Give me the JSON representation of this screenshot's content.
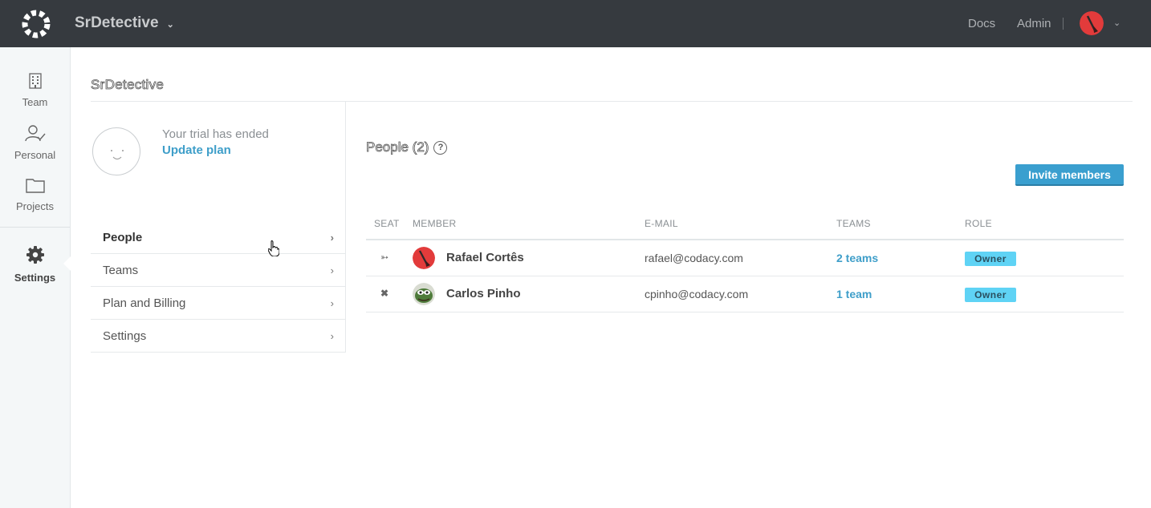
{
  "header": {
    "org_name": "SrDetective",
    "docs_label": "Docs",
    "admin_label": "Admin"
  },
  "nav": {
    "items": [
      {
        "label": "Team",
        "icon": "building-icon"
      },
      {
        "label": "Personal",
        "icon": "user-check-icon"
      },
      {
        "label": "Projects",
        "icon": "folder-icon"
      },
      {
        "label": "Settings",
        "icon": "gear-icon",
        "active": true
      }
    ]
  },
  "page": {
    "title": "SrDetective",
    "trial_text": "Your trial has ended",
    "update_plan_label": "Update plan"
  },
  "side_menu": {
    "items": [
      {
        "label": "People",
        "active": true
      },
      {
        "label": "Teams"
      },
      {
        "label": "Plan and Billing"
      },
      {
        "label": "Settings"
      }
    ]
  },
  "people": {
    "title": "People (2)",
    "invite_label": "Invite members",
    "columns": [
      "SEAT",
      "MEMBER",
      "E-MAIL",
      "TEAMS",
      "ROLE"
    ],
    "rows": [
      {
        "seat_icon": "sign-out-icon",
        "name": "Rafael Cortês",
        "email": "rafael@codacy.com",
        "teams": "2 teams",
        "role": "Owner"
      },
      {
        "seat_icon": "close-icon",
        "name": "Carlos Pinho",
        "email": "cpinho@codacy.com",
        "teams": "1 team",
        "role": "Owner"
      }
    ]
  },
  "colors": {
    "topbar": "#363a3f",
    "accent": "#3a9fcf",
    "link": "#3e9ec9",
    "badge": "#5fd3f5"
  }
}
